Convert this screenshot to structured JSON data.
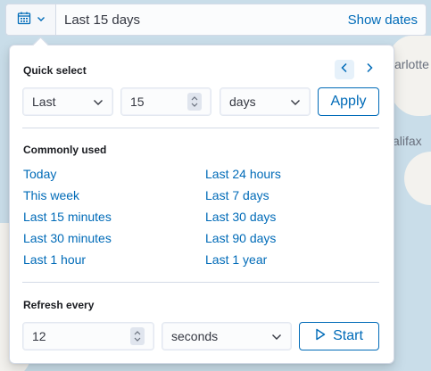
{
  "datebar": {
    "range_text": "Last 15 days",
    "show_dates_label": "Show dates"
  },
  "map": {
    "labels": [
      "arlotte",
      "alifax"
    ]
  },
  "quick_select": {
    "title": "Quick select",
    "direction": "Last",
    "amount": "15",
    "unit": "days",
    "apply_label": "Apply"
  },
  "commonly_used": {
    "title": "Commonly used",
    "left": [
      "Today",
      "This week",
      "Last 15 minutes",
      "Last 30 minutes",
      "Last 1 hour"
    ],
    "right": [
      "Last 24 hours",
      "Last 7 days",
      "Last 30 days",
      "Last 90 days",
      "Last 1 year"
    ]
  },
  "refresh": {
    "title": "Refresh every",
    "interval": "12",
    "unit": "seconds",
    "start_label": "Start"
  },
  "colors": {
    "accent": "#006bb8",
    "border": "#d3dae6"
  }
}
